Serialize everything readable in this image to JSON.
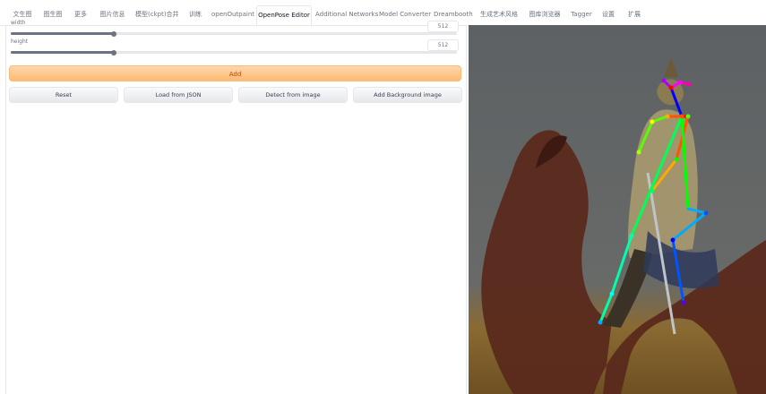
{
  "tabs": [
    {
      "label": "文生图"
    },
    {
      "label": "图生图"
    },
    {
      "label": "更多"
    },
    {
      "label": "图片信息"
    },
    {
      "label": "模型(ckpt)合并"
    },
    {
      "label": "训练"
    },
    {
      "label": "openOutpaint"
    },
    {
      "label": "OpenPose Editor",
      "active": true
    },
    {
      "label": "Additional Networks"
    },
    {
      "label": "Model Converter"
    },
    {
      "label": "Dreambooth"
    },
    {
      "label": "生成艺术风格"
    },
    {
      "label": "图库浏览器"
    },
    {
      "label": "Tagger"
    },
    {
      "label": "设置"
    },
    {
      "label": "扩展"
    }
  ],
  "editor": {
    "width_label": "width",
    "width_value": "512",
    "height_label": "height",
    "height_value": "512",
    "add_label": "Add",
    "reset_label": "Reset",
    "load_json_label": "Load from JSON",
    "detect_label": "Detect from image",
    "add_background_label": "Add Background image"
  },
  "sliders": {
    "width_fraction": 0.23,
    "height_fraction": 0.23
  },
  "colors": {
    "primary_button_bg": "#fdba74",
    "primary_button_text": "#c2410c",
    "slider_fill": "#6b7280",
    "canvas_sky": "#5f6366",
    "canvas_ground": "#8a6a32"
  },
  "pose_colors": [
    "#ff0000",
    "#ff5500",
    "#ffaa00",
    "#ffff00",
    "#aaff00",
    "#55ff00",
    "#00ff00",
    "#00ff55",
    "#00ffaa",
    "#00ffff",
    "#00aaff",
    "#0055ff",
    "#0000ff",
    "#5500ff",
    "#aa00ff",
    "#ff00ff",
    "#ff00aa"
  ]
}
